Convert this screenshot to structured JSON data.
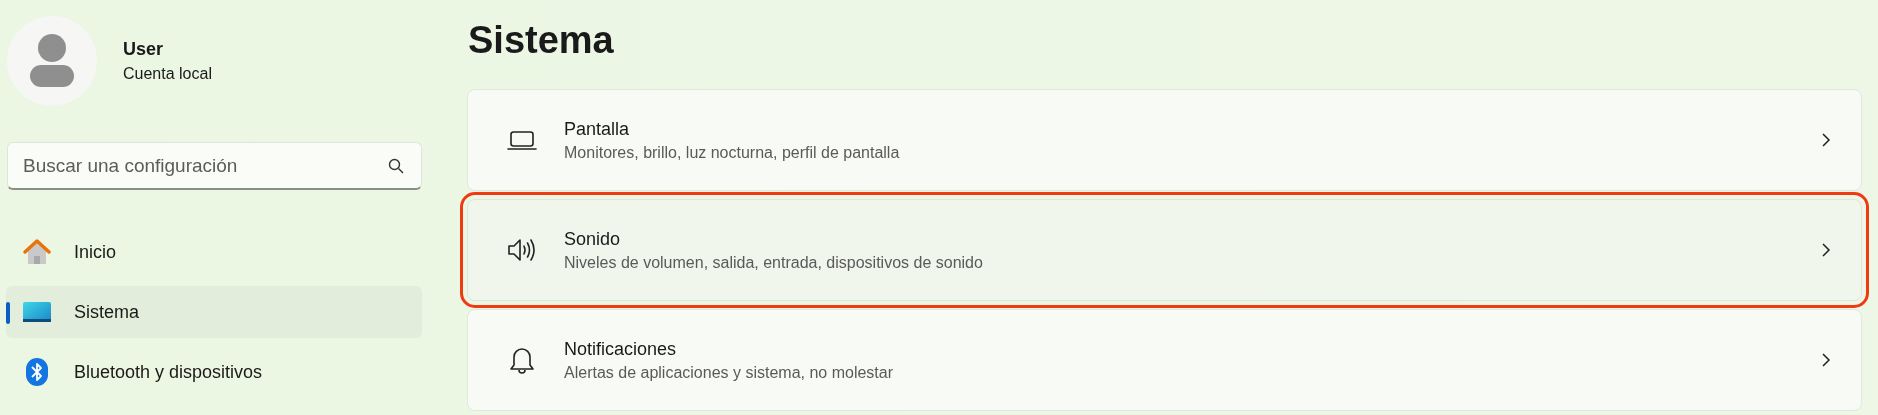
{
  "user": {
    "name": "User",
    "account": "Cuenta local"
  },
  "search": {
    "placeholder": "Buscar una configuración"
  },
  "nav": [
    {
      "label": "Inicio",
      "kind": "home",
      "selected": false
    },
    {
      "label": "Sistema",
      "kind": "system",
      "selected": true
    },
    {
      "label": "Bluetooth y dispositivos",
      "kind": "bluetooth",
      "selected": false
    }
  ],
  "page_title": "Sistema",
  "settings": [
    {
      "title": "Pantalla",
      "description": "Monitores, brillo, luz nocturna, perfil de pantalla",
      "kind": "display",
      "highlighted": false
    },
    {
      "title": "Sonido",
      "description": "Niveles de volumen, salida, entrada, dispositivos de sonido",
      "kind": "sound",
      "highlighted": true
    },
    {
      "title": "Notificaciones",
      "description": "Alertas de aplicaciones y sistema, no molestar",
      "kind": "bell",
      "highlighted": false
    }
  ]
}
